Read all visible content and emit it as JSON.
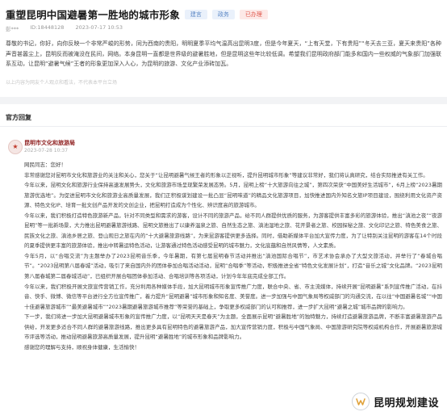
{
  "question": {
    "title": "重塑昆明中国避暑第一胜地的城市形象",
    "tags": [
      "建言",
      "政务",
      "已办理"
    ],
    "author": "彭***",
    "message_id": "ID:18448128",
    "time": "2023-07-17 10:53",
    "body": "尊敬的书记，你好，向你反映一个非常严峻的形势，同为西南的贵阳，明明夏季平均气温高出昆明3度，但是今年夏天，“上有天堂，下有贵阳”“冬天去三亚，夏天来贵阳”各种声音甚嚣尘上，昆明反而被淹没在民间，网络。本身昆明一直都是世界级的避暑胜地，但是昆明这些年比较低调。希望我们昆明政府部门能多和国内一些权威的气象部门加强联系互动，让昆明“避暑气候”王者的形象更加深入人心，为昆明的旅游、文化产业添砖加瓦。",
    "disclaimer": "以上内容为网友个人观点和看法，不代表本平台立场"
  },
  "answers": {
    "section_title": "官方回复",
    "department": "昆明市文化和旅游局",
    "time": "2023-07-28 10:37",
    "paragraphs": [
      "网民同志：您好！",
      "非常感谢您对昆明市文化和旅游业的关注和关心，您关于“让昆明避暑气候王者的形象以正视听，提升昆明城市形象”等建议非常好，我们将认真研究，结合实际推进有关工作。",
      "今年以来，昆明文化和旅游行业保持高速发展势头，文化和旅游市场呈现繁荣发展态势。5月，昆明上榜“十大旅游向往之城”，第四次荣获“中国美好生活城市”，6月上榜“2023暑期旅游优选地”。为促进昆明市文化和旅游业高质量发展，我们正积极谋划建设一批凸显“昆明味道”的精品文化旅游项目，加快推进国内外知名文旅IP项目建设，围绕利用文化资产资源、特色文化IP、培育一批文创产品开发的文创企业，把昆明打造成为个性化、辨识度高的旅游城市。",
      "今年以来，我们积极打造特色旅游新产品，针对不同类型和需求的游客，设计不同的旅游产品，给不同人群提供优质的服务，为游客提供丰富多彩的旅游体验，推出“滇池之夜”“夜游昆明”等一批新场景，大力推出昆明避暑旅游线路、昆明文旅推出了以康养温泉之旅、自然生态之旅、滇池湿地之旅、花开景者之旅、校园探秘之旅、文化印记之旅、特色美食之旅、民族文化之旅、滇池乡居之旅、登山观日之旅在内的“十大避暑旅游线路”，为来昆游客提供更多选择。同时，借助新媒体平台加大宣传力度，为了让特别关注昆明的游客在14个时段的夏季提供更丰富的旅游体验，推出中转暑运特色活动，让游客通过特色活动感受昆明的城市魅力，文化底蕴和自然风情等，人文素质。",
      "今年5月，以“合唱交流”为主题举办了2023昆明音乐季，今年暑期，有第七届昆明春节活动并推出“滇池国际合唱节”，市艺术协会承办了大型文旅活动，并举行了“春城合唱节”。“2023昆明第八届春城”活动，吸引了来自国内外的团体参加合唱活动活动，昆明“合唱季”等活动，积极推进全省“特色文化发展计划”，打造“音乐之城”文化品牌。“2023昆明第八届春城第二届春城活动”，已组织开展合唱团体参加活动、合唱培训等各项活动，计划今年年底完成全部工作。",
      "今年以来，我们积极开展文旅宣传营销工作，充分利用各种媒体手段，加大昆明城市形象宣传推广力度，联合中央、省、市主流媒体，持续开展“昆明避暑”系列宣传推广活动，在抖音、快手、微博、微信等平台进行全方位宣传推广，着力提升“昆明避暑”城市形象和知名度、美誉度。进一步加强与中国气象局等权威部门的沟通交流，在以往“中国避暑名城”“中国十佳避暑旅游城市”“最美避暑城市”“2023暑期避暑旅游城市推荐”等荣誉的基础上，争取更多权威部门的认可和推荐，进一步扩大昆明“避暑之城”城市品牌的影响力。",
      "下一步，我们将进一步加大昆明避暑城市形象的宣传推广力度，以“昆明天天是春天”为主题，全面展示昆明“避暑胜地”的独特魅力，持续打造避暑旅游品牌，不断丰富避暑旅游产品供给，开发更多适合不同人群的避暑旅游线路，推出更多具有昆明特色的避暑旅游产品，加大宣传营销力度，积极与中国气象局、中国旅游研究院等权威机构合作，开展避暑旅游城市评选等活动，推动昆明避暑旅游高质量发展，提升昆明“避暑胜地”的城市形象和品牌影响力。",
      "感谢您的理解与支持，顺祝身体健康，生活愉快！"
    ]
  },
  "watermark": {
    "text": "昆明规划建设",
    "icon": "wechat-channel-icon"
  },
  "colors": {
    "accent_red": "#e0554a",
    "department_red": "#8e1d1d",
    "tag_blue": "#5a86c5"
  }
}
